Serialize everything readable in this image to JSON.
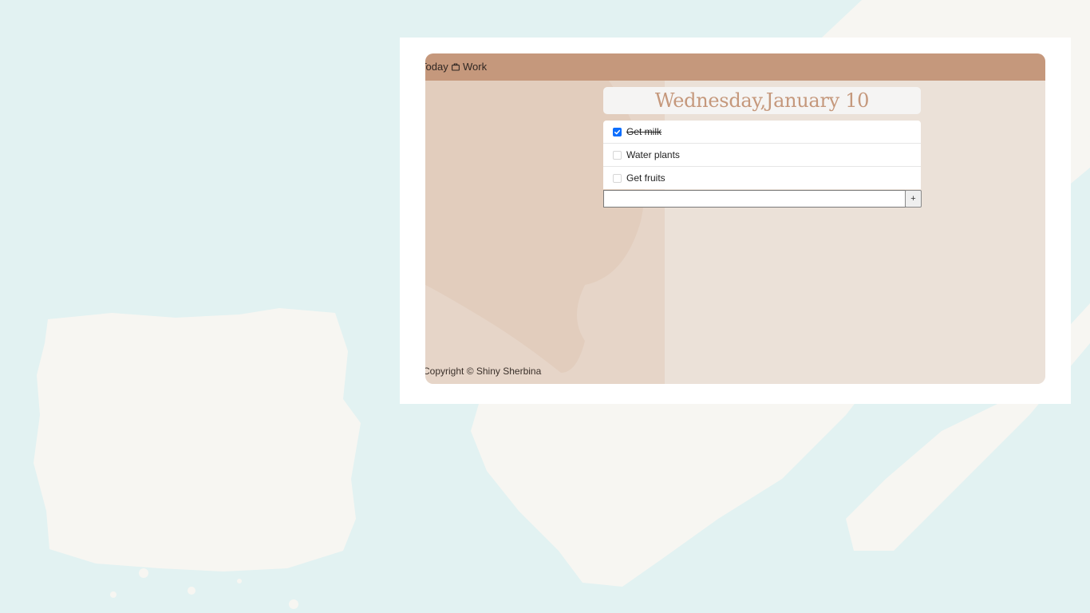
{
  "nav": {
    "today_label": "Today",
    "work_label": "Work",
    "work_icon": "briefcase-icon"
  },
  "day_title": "Wednesday,January 10",
  "tasks": [
    {
      "label": "Get milk",
      "checked": true
    },
    {
      "label": "Water plants",
      "checked": false
    },
    {
      "label": "Get fruits",
      "checked": false
    }
  ],
  "new_task": {
    "value": "",
    "add_button_label": "+"
  },
  "footer_text": "Copyright © Shiny Sherbina",
  "colors": {
    "page_background": "#e2f2f2",
    "accent": "#c5987c",
    "app_background": "#ece1d8",
    "checkbox_checked": "#0d6efd"
  }
}
